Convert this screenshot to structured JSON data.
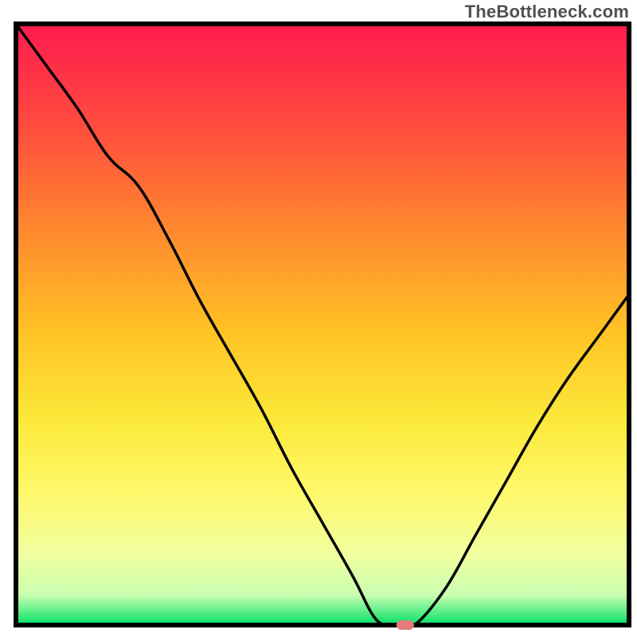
{
  "attribution": "TheBottleneck.com",
  "chart_data": {
    "type": "line",
    "title": "",
    "xlabel": "",
    "ylabel": "",
    "xlim": [
      0,
      100
    ],
    "ylim": [
      0,
      100
    ],
    "x": [
      0,
      5,
      10,
      15,
      20,
      25,
      30,
      35,
      40,
      45,
      50,
      55,
      58,
      60,
      62,
      65,
      70,
      75,
      80,
      85,
      90,
      95,
      100
    ],
    "values": [
      100,
      93,
      86,
      78,
      73,
      64,
      54,
      45,
      36,
      26,
      17,
      8,
      2,
      0,
      0,
      0,
      6,
      15,
      24,
      33,
      41,
      48,
      55
    ],
    "marker": {
      "x": 63.5,
      "y": 0
    },
    "background_gradient_colors": [
      "#ff1a4f",
      "#ff4f3d",
      "#ff8b2e",
      "#ffc524",
      "#fbe93a",
      "#fff86a",
      "#f1ff9f",
      "#c9ffb0",
      "#00e066"
    ],
    "plot_border_color": "#000000",
    "curve_color": "#000000",
    "marker_color": "#e77a7a"
  }
}
